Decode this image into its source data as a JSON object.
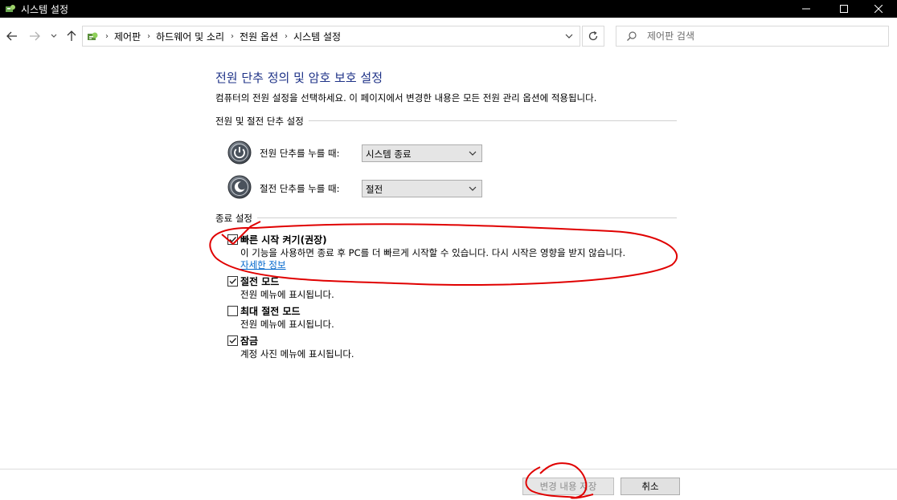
{
  "window": {
    "title": "시스템 설정"
  },
  "nav": {
    "breadcrumbs": [
      "제어판",
      "하드웨어 및 소리",
      "전원 옵션",
      "시스템 설정"
    ],
    "search_placeholder": "제어판 검색"
  },
  "page": {
    "heading": "전원 단추 정의 및 암호 보호 설정",
    "description": "컴퓨터의 전원 설정을 선택하세요. 이 페이지에서 변경한 내용은 모든 전원 관리 옵션에 적용됩니다."
  },
  "buttons_section": {
    "title": "전원 및 절전 단추 설정",
    "power_button_label": "전원 단추를 누를 때:",
    "power_button_value": "시스템 종료",
    "sleep_button_label": "절전 단추를 누를 때:",
    "sleep_button_value": "절전"
  },
  "shutdown_section": {
    "title": "종료 설정",
    "options": [
      {
        "title": "빠른 시작 켜기(권장)",
        "desc": "이 기능을 사용하면 종료 후 PC를 더 빠르게 시작할 수 있습니다. 다시 시작은 영향을 받지 않습니다.",
        "link": "자세한 정보",
        "checked": true
      },
      {
        "title": "절전 모드",
        "desc": "전원 메뉴에 표시됩니다.",
        "checked": true
      },
      {
        "title": "최대 절전 모드",
        "desc": "전원 메뉴에 표시됩니다.",
        "checked": false
      },
      {
        "title": "잠금",
        "desc": "계정 사진 메뉴에 표시됩니다.",
        "checked": true
      }
    ]
  },
  "footer": {
    "save_label": "변경 내용 저장",
    "cancel_label": "취소"
  },
  "colors": {
    "heading": "#1e3287",
    "link": "#0066cc",
    "annotation": "#e00000"
  }
}
